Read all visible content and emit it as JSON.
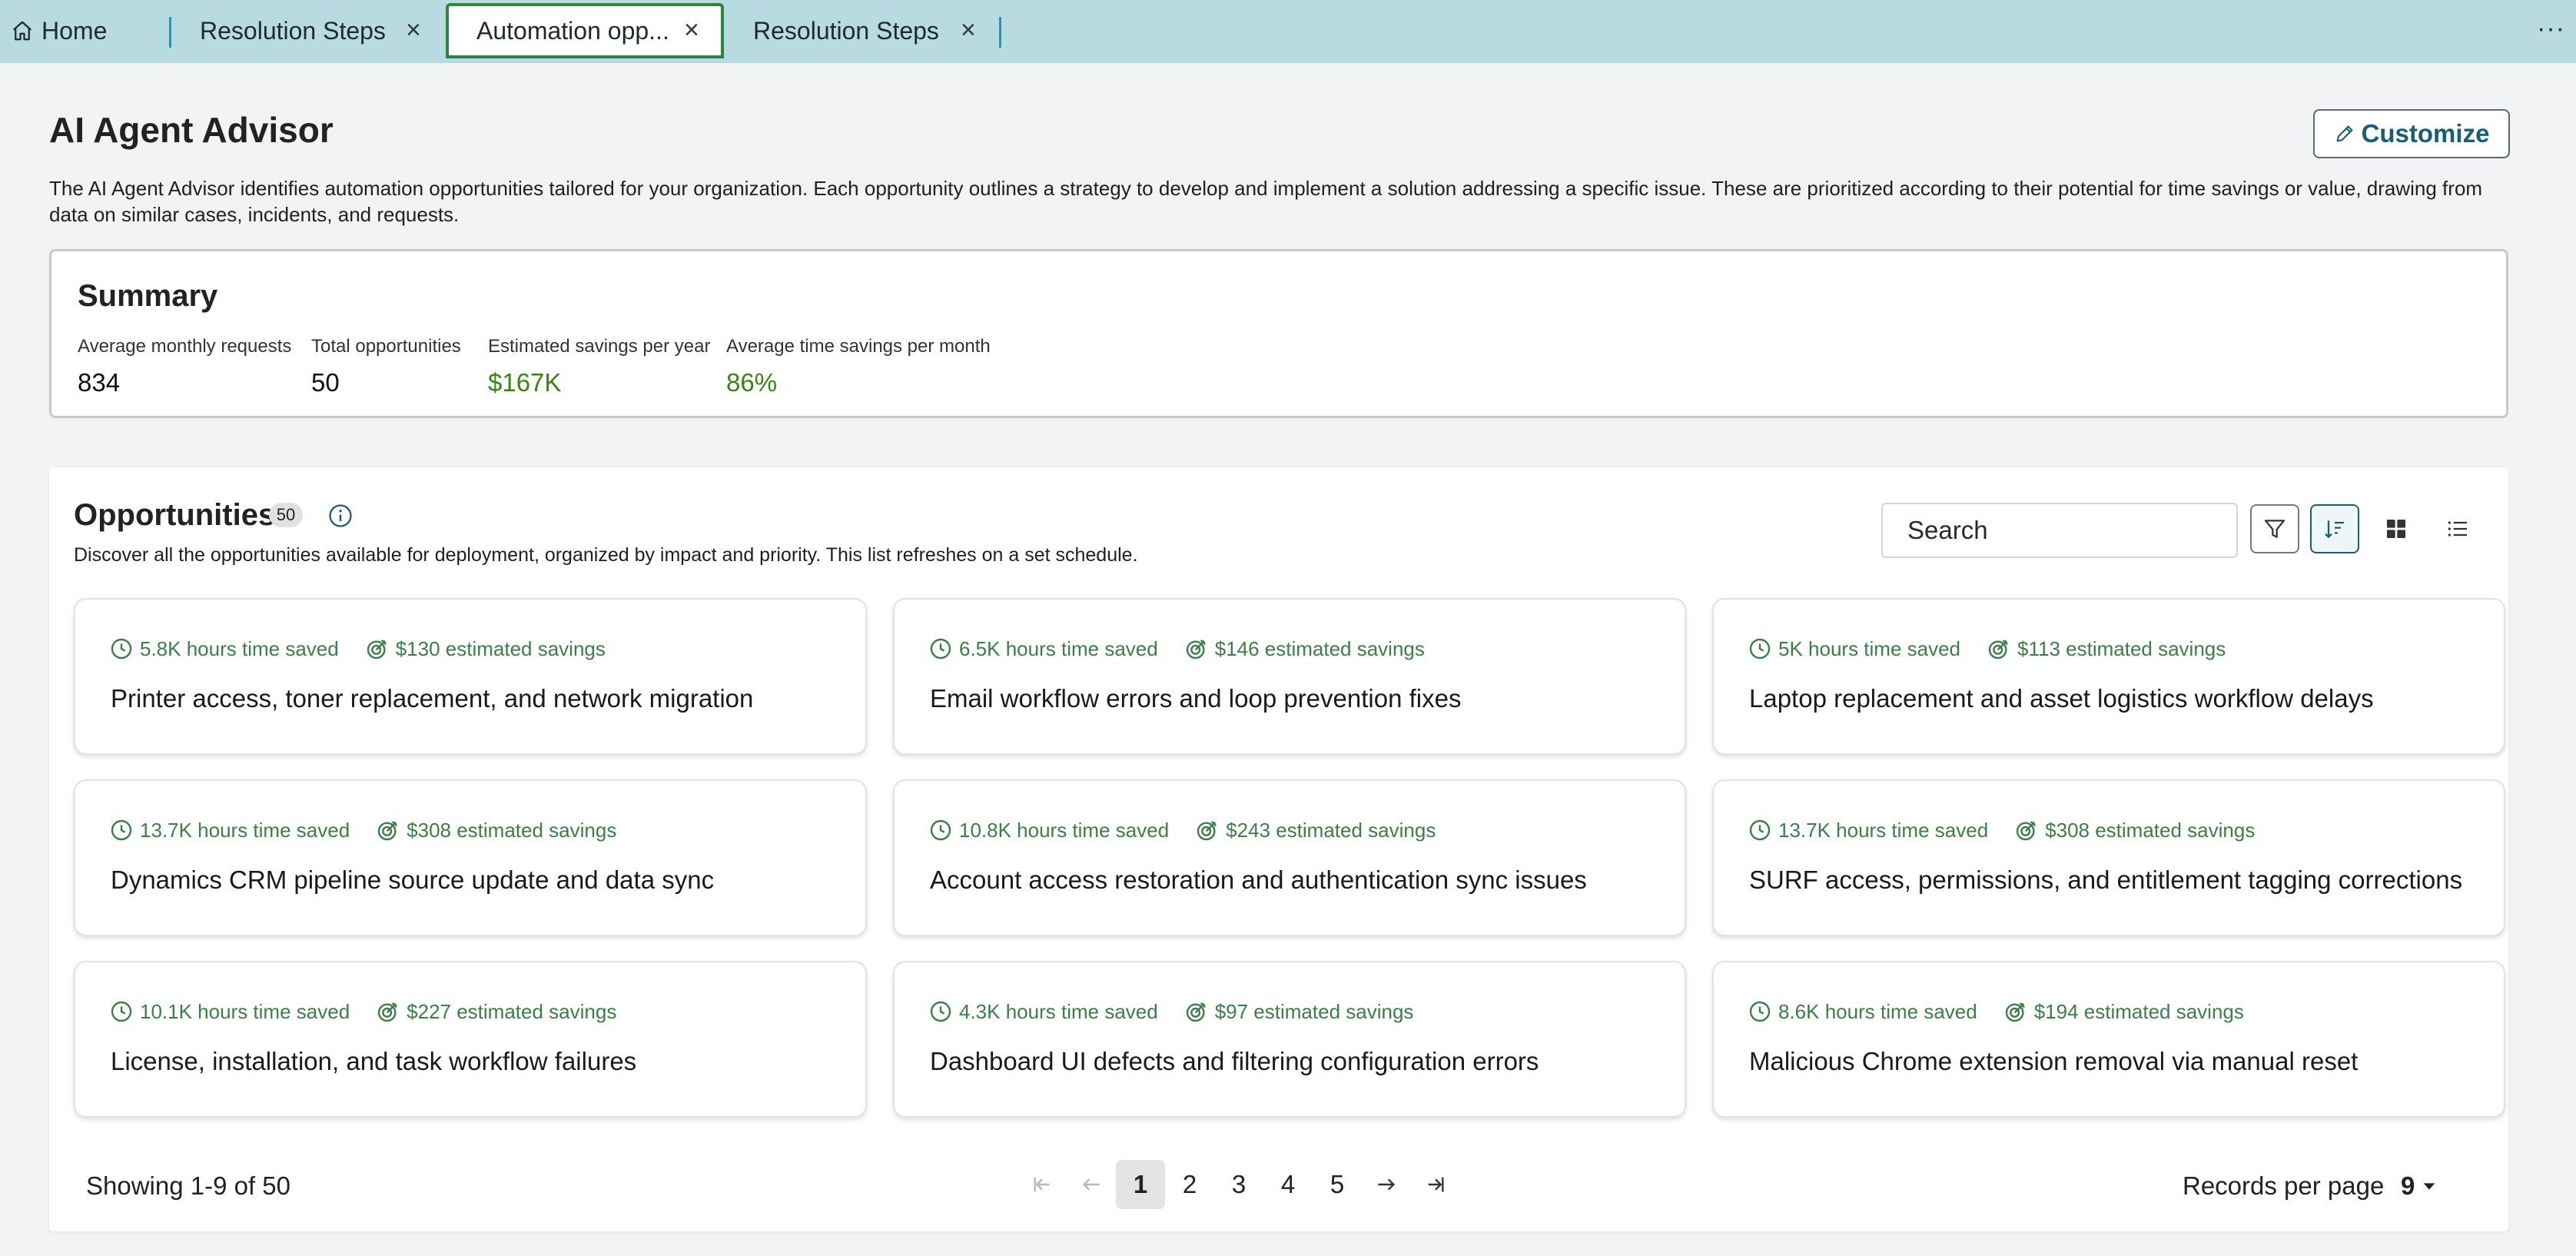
{
  "tabs": {
    "home": "Home",
    "tab1": "Resolution Steps",
    "tab2": "Automation opp...",
    "tab3": "Resolution Steps",
    "close": "×",
    "more": "···"
  },
  "page": {
    "title": "AI Agent Advisor",
    "customize": "Customize",
    "intro": "The AI Agent Advisor identifies automation opportunities tailored for your organization. Each opportunity outlines a strategy to develop and implement a solution addressing a specific issue. These are prioritized according to their potential for time savings or value, drawing from data on similar cases, incidents, and requests."
  },
  "summary": {
    "title": "Summary",
    "metrics": [
      {
        "label": "Average monthly requests",
        "value": "834"
      },
      {
        "label": "Total opportunities",
        "value": "50"
      },
      {
        "label": "Estimated savings per year",
        "value": "$167K"
      },
      {
        "label": "Average time savings per month",
        "value": "86%"
      }
    ]
  },
  "opportunities": {
    "title": "Opportunities",
    "count": "50",
    "description": "Discover all the opportunities available for deployment, organized by impact and priority. This list refreshes on a set schedule.",
    "search_placeholder": "Search",
    "cards": [
      {
        "hours": "5.8K hours time saved",
        "savings": "$130 estimated savings",
        "title": "Printer access, toner replacement, and network migration"
      },
      {
        "hours": "6.5K hours time saved",
        "savings": "$146 estimated savings",
        "title": "Email workflow errors and loop prevention fixes"
      },
      {
        "hours": "5K hours time saved",
        "savings": "$113 estimated savings",
        "title": "Laptop replacement and asset logistics workflow delays"
      },
      {
        "hours": "13.7K hours time saved",
        "savings": "$308 estimated savings",
        "title": "Dynamics CRM pipeline source update and data sync"
      },
      {
        "hours": "10.8K hours time saved",
        "savings": "$243 estimated savings",
        "title": "Account access restoration and authentication sync issues"
      },
      {
        "hours": "13.7K hours time saved",
        "savings": "$308 estimated savings",
        "title": "SURF access, permissions, and entitlement tagging corrections"
      },
      {
        "hours": "10.1K hours time saved",
        "savings": "$227 estimated savings",
        "title": "License, installation, and task workflow failures"
      },
      {
        "hours": "4.3K hours time saved",
        "savings": "$97 estimated savings",
        "title": "Dashboard UI defects and filtering configuration errors"
      },
      {
        "hours": "8.6K hours time saved",
        "savings": "$194 estimated savings",
        "title": "Malicious Chrome extension removal via manual reset"
      }
    ]
  },
  "pagination": {
    "showing": "Showing 1-9 of 50",
    "pages": [
      "1",
      "2",
      "3",
      "4",
      "5"
    ],
    "current_page": "1",
    "records_label": "Records per page",
    "records_value": "9"
  },
  "colors": {
    "accent": "#2e8540",
    "tabbar": "#b8dbe2",
    "savings_text": "#3c7e48",
    "metric_green": "#3a8416"
  },
  "icons": [
    "home-icon",
    "close-icon",
    "more-icon",
    "pencil-icon",
    "info-icon",
    "search-icon",
    "filter-icon",
    "sort-icon",
    "grid-view-icon",
    "list-view-icon",
    "clock-icon",
    "target-icon",
    "first-page-icon",
    "prev-page-icon",
    "next-page-icon",
    "last-page-icon",
    "caret-down-icon"
  ]
}
